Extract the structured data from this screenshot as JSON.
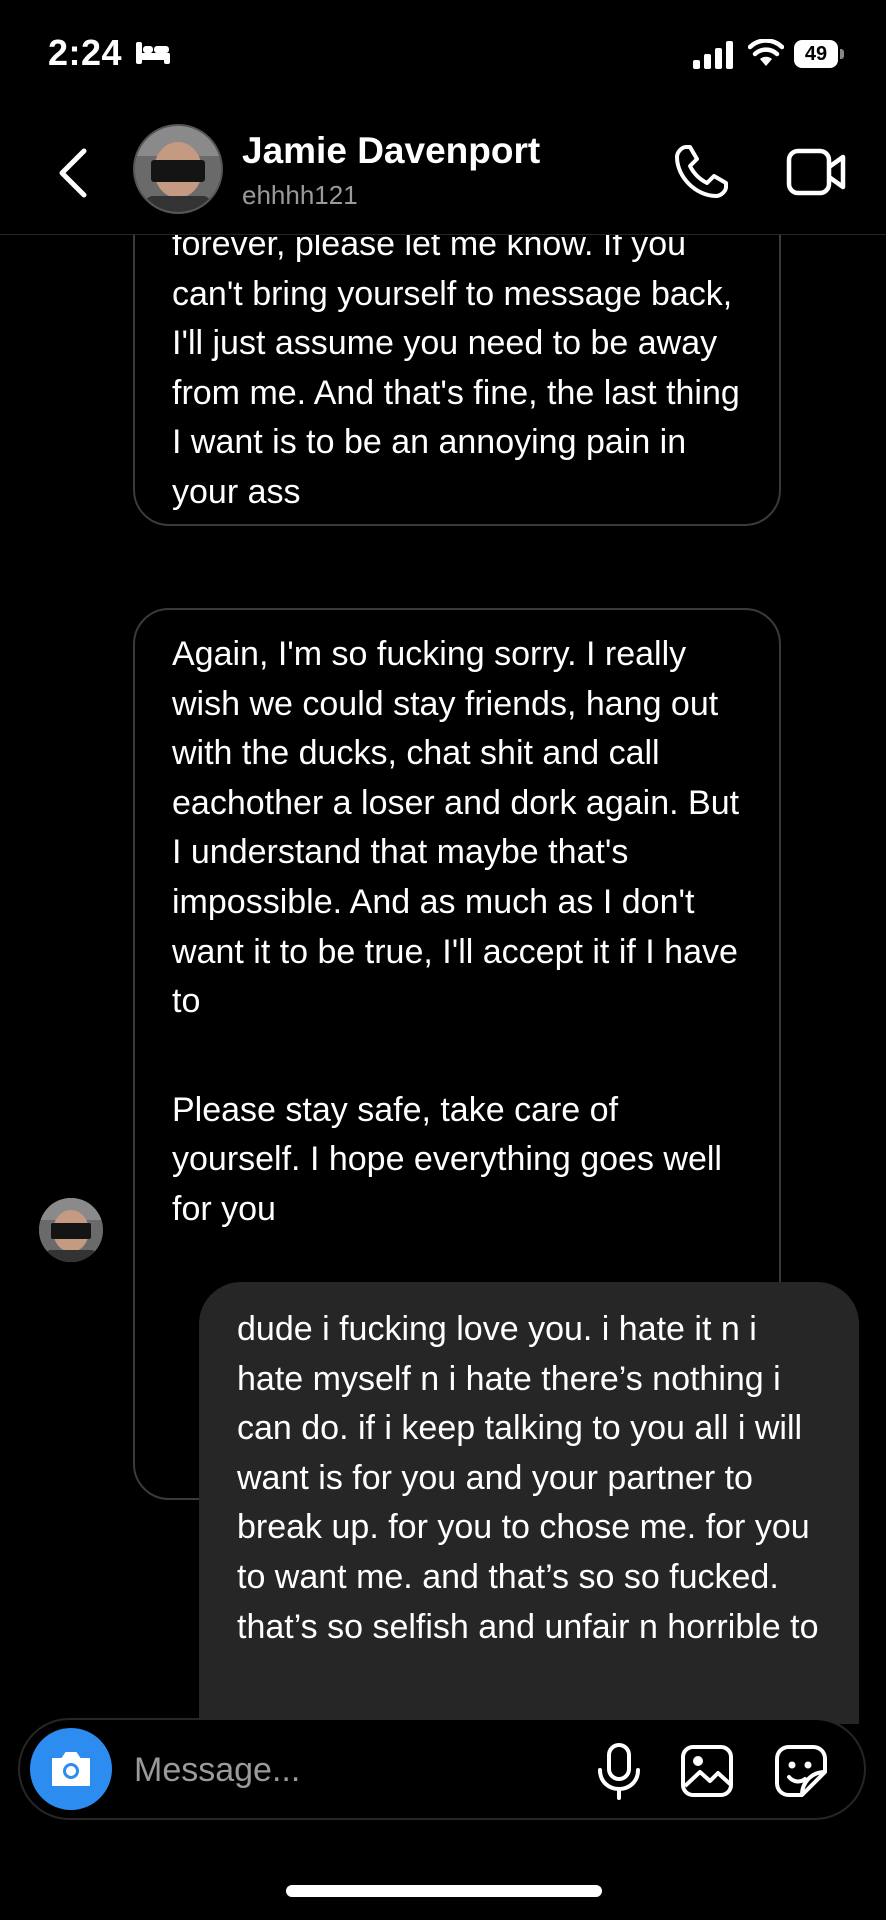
{
  "status_bar": {
    "time": "2:24",
    "battery": "49",
    "icons": [
      "bed-icon",
      "signal-icon",
      "wifi-icon",
      "battery-icon"
    ]
  },
  "header": {
    "name": "Jamie Davenport",
    "handle": "ehhhh121",
    "icons": [
      "back-chevron-icon",
      "phone-call-icon",
      "video-camera-icon"
    ]
  },
  "messages": [
    {
      "sender": "them",
      "paragraphs": [
        "forever, please let me know. If you can't bring yourself to message back, I'll just assume you need to be away from me. And that's fine, the last thing I want is to be an annoying pain in your ass"
      ]
    },
    {
      "sender": "them",
      "paragraphs": [
        "Again, I'm so fucking sorry. I really wish we could stay friends, hang out with the ducks, chat shit and call eachother a loser and dork again. But I understand that maybe that's impossible. And as much as I don't want it to be true, I'll accept it if I have to",
        "Please stay safe, take care of yourself. I hope everything goes well for you"
      ]
    },
    {
      "sender": "me",
      "paragraphs": [
        "dude i fucking love you. i hate it n i hate myself n i hate there’s nothing i can do. if i keep talking to you all i will want is for you and your partner to break up. for you to chose me. for you to want me. and that’s so so fucked. that’s so selfish and unfair n horrible to"
      ]
    }
  ],
  "composer": {
    "placeholder": "Message...",
    "icons": [
      "camera-icon",
      "microphone-icon",
      "gallery-icon",
      "sticker-icon"
    ],
    "camera_color": "#2d8cf0"
  },
  "colors": {
    "background": "#000000",
    "sent_bubble": "#262626",
    "received_border": "#3a3a3a",
    "secondary_text": "#9a9a9a"
  }
}
